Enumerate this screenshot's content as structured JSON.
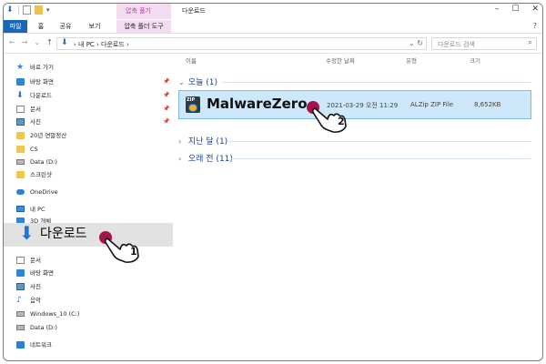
{
  "window": {
    "title": "다운로드",
    "context_group": "압축 풀기",
    "controls": [
      "–",
      "☐",
      "✕"
    ]
  },
  "ribbon": {
    "tabs": [
      "파일",
      "홈",
      "공유",
      "보기",
      "압축 폴더 도구"
    ],
    "help": "?"
  },
  "address": {
    "path": "› 내 PC › 다운로드 ›",
    "search_placeholder": "다운로드 검색"
  },
  "nav": {
    "items": [
      {
        "label": "바로 가기",
        "icon": "star-icon"
      },
      {
        "label": "바탕 화면",
        "icon": "desktop-icon",
        "pinned": true
      },
      {
        "label": "다운로드",
        "icon": "download-icon",
        "pinned": true
      },
      {
        "label": "문서",
        "icon": "document-icon",
        "pinned": true
      },
      {
        "label": "사진",
        "icon": "pictures-icon",
        "pinned": true
      },
      {
        "label": "20년 연말정산",
        "icon": "folder-icon"
      },
      {
        "label": "CS",
        "icon": "folder-icon"
      },
      {
        "label": "Data (D:)",
        "icon": "drive-icon"
      },
      {
        "label": "스크린샷",
        "icon": "folder-icon"
      },
      {
        "label": "OneDrive",
        "icon": "onedrive-icon"
      },
      {
        "label": "내 PC",
        "icon": "pc-icon"
      },
      {
        "label": "3D 개체",
        "icon": "3d-objects-icon"
      },
      {
        "label": "다운로드",
        "icon": "download-icon"
      },
      {
        "label": "문서",
        "icon": "document-icon"
      },
      {
        "label": "바탕 화면",
        "icon": "desktop-icon"
      },
      {
        "label": "사진",
        "icon": "pictures-icon"
      },
      {
        "label": "음악",
        "icon": "music-icon"
      },
      {
        "label": "Windows_10 (C:)",
        "icon": "drive-icon"
      },
      {
        "label": "Data (D:)",
        "icon": "drive-icon"
      },
      {
        "label": "네트워크",
        "icon": "network-icon"
      }
    ],
    "pin_glyph": "📌"
  },
  "columns": {
    "name": "이름",
    "modified": "수정한 날짜",
    "type": "유형",
    "size": "크기"
  },
  "groups": {
    "today": "오늘 (1)",
    "last_month": "지난 달 (1)",
    "earlier": "오래 전 (11)"
  },
  "file": {
    "name": "MalwareZero",
    "modified": "2021-03-29 오전 11:29",
    "type": "ALZip ZIP File",
    "size": "8,652KB",
    "icon_text": "ZIP"
  },
  "callouts": {
    "step1": "1",
    "step2": "2"
  }
}
